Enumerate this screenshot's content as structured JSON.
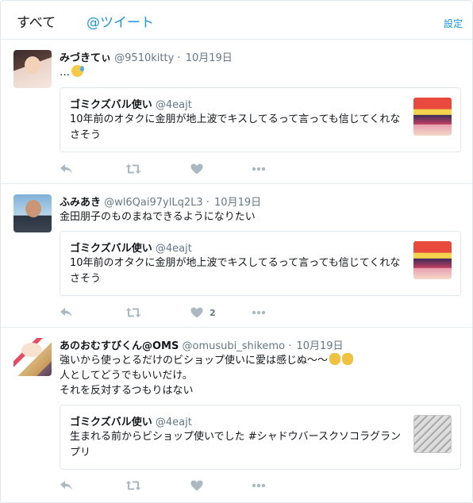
{
  "tabs": {
    "all": "すべて",
    "tweets": "@ツイート"
  },
  "settings_label": "設定",
  "tweets": [
    {
      "name": "みづきてぃ",
      "handle": "@9510kitty",
      "sep": "·",
      "date": "10月19日",
      "text_lines": [
        "…"
      ],
      "quote": {
        "name": "ゴミクズバル使い",
        "handle": "@4eajt",
        "text": "10年前のオタクに金朋が地上波でキスしてるって言っても信じてくれなさそう"
      },
      "like_count": ""
    },
    {
      "name": "ふみあき",
      "handle": "@wl6Qai97ylLq2L3",
      "sep": "·",
      "date": "10月19日",
      "text_lines": [
        "金田朋子のものまねできるようになりたい"
      ],
      "quote": {
        "name": "ゴミクズバル使い",
        "handle": "@4eajt",
        "text": "10年前のオタクに金朋が地上波でキスしてるって言っても信じてくれなさそう"
      },
      "like_count": "2"
    },
    {
      "name": "あのおむすびくん@OMS",
      "handle": "@omusubi_shikemo",
      "sep": "·",
      "date": "10月19日",
      "text_lines": [
        "強いから使っとるだけのビショップ使いに愛は感じぬ〜〜",
        "人としてどうでもいいだけ。",
        "それを反対するつもりはない"
      ],
      "quote": {
        "name": "ゴミクズバル使い",
        "handle": "@4eajt",
        "text": "生まれる前からビショップ使いでした #シャドウバースクソコラグランプリ"
      },
      "like_count": ""
    }
  ],
  "icons": {
    "reply": "reply-icon",
    "retweet": "retweet-icon",
    "like": "heart-icon",
    "more": "more-icon"
  },
  "colors": {
    "accent": "#1b95e0",
    "icon": "#aab8c2",
    "secondary_text": "#657786",
    "border": "#e1e8ed"
  }
}
